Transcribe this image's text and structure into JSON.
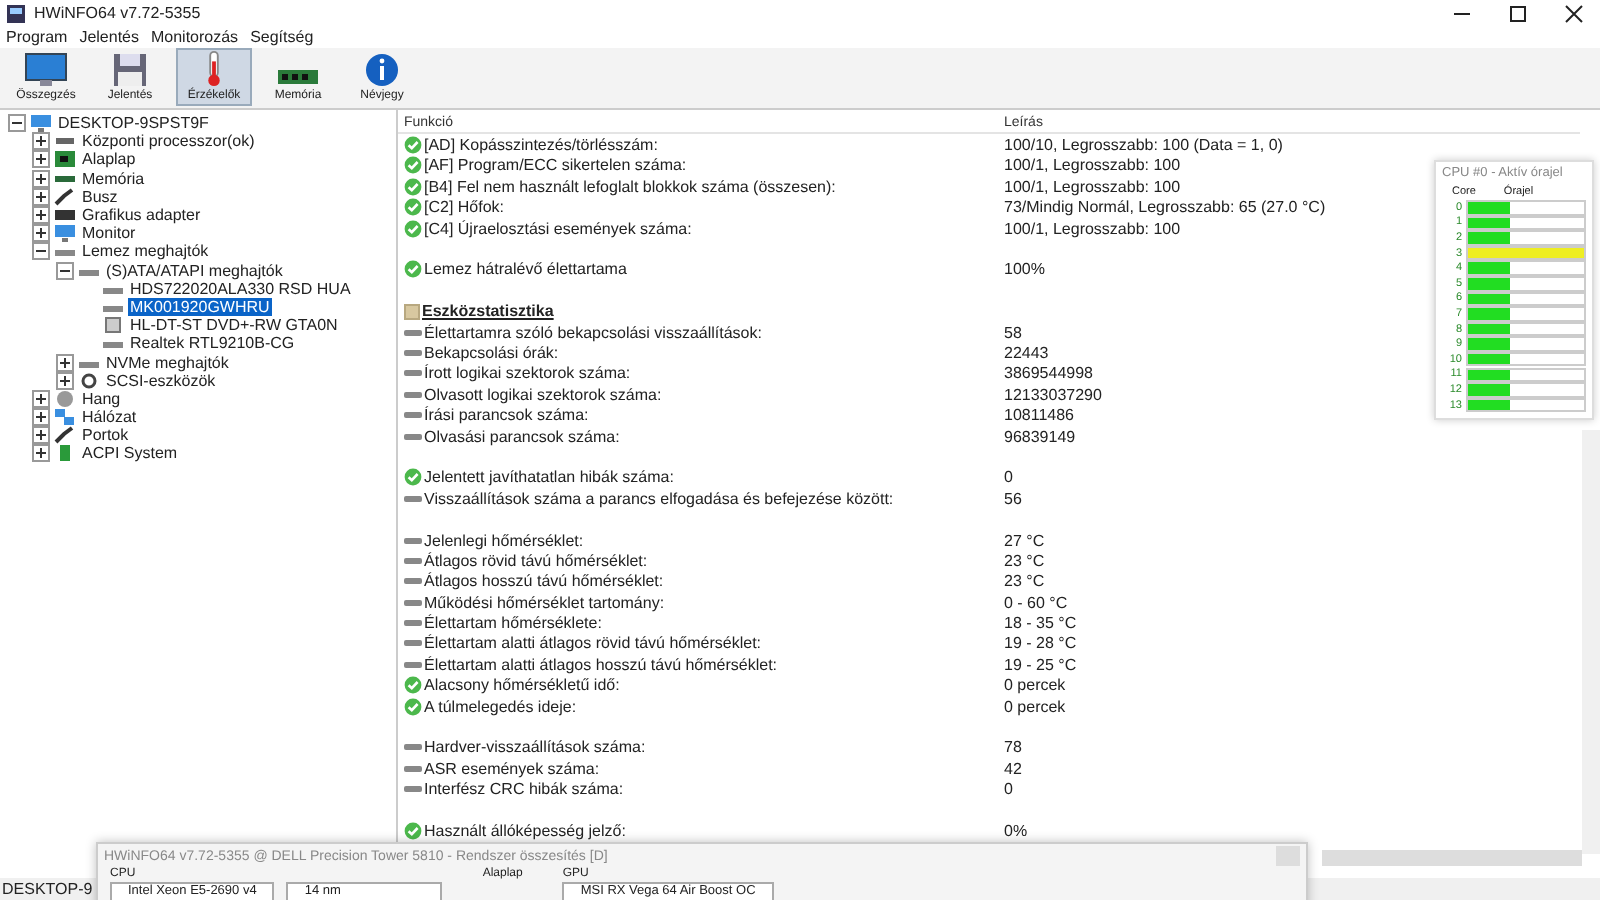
{
  "window": {
    "title": "HWiNFO64 v7.72-5355"
  },
  "menu": [
    "Program",
    "Jelentés",
    "Monitorozás",
    "Segítség"
  ],
  "toolbar": [
    {
      "label": "Összegzés",
      "kind": "monitor",
      "selected": false
    },
    {
      "label": "Jelentés",
      "kind": "floppy",
      "selected": false
    },
    {
      "label": "Érzékelők",
      "kind": "thermometer",
      "selected": true
    },
    {
      "label": "Memória",
      "kind": "memory",
      "selected": false
    },
    {
      "label": "Névjegy",
      "kind": "info",
      "selected": false
    }
  ],
  "tree": {
    "items": [
      {
        "label": "DESKTOP-9SPST9F",
        "kind": "computer",
        "expanded": true,
        "selected": false,
        "children": [
          {
            "label": "Központi processzor(ok)",
            "kind": "cpu",
            "expanded": false,
            "selected": false
          },
          {
            "label": "Alaplap",
            "kind": "board",
            "expanded": false,
            "selected": false
          },
          {
            "label": "Memória",
            "kind": "memory",
            "expanded": false,
            "selected": false
          },
          {
            "label": "Busz",
            "kind": "bus",
            "expanded": false,
            "selected": false
          },
          {
            "label": "Grafikus adapter",
            "kind": "gpu",
            "expanded": false,
            "selected": false
          },
          {
            "label": "Monitor",
            "kind": "monitor",
            "expanded": false,
            "selected": false
          },
          {
            "label": "Lemez meghajtók",
            "kind": "drive",
            "expanded": true,
            "selected": false,
            "children": [
              {
                "label": "(S)ATA/ATAPI meghajtók",
                "kind": "drive",
                "expanded": true,
                "selected": false,
                "children": [
                  {
                    "label": "HDS722020ALA330 RSD HUA",
                    "kind": "drive",
                    "selected": false
                  },
                  {
                    "label": "MK001920GWHRU",
                    "kind": "drive",
                    "selected": true
                  },
                  {
                    "label": "HL-DT-ST DVD+-RW GTA0N",
                    "kind": "optical",
                    "selected": false
                  },
                  {
                    "label": "Realtek RTL9210B-CG",
                    "kind": "drive",
                    "selected": false
                  }
                ]
              },
              {
                "label": "NVMe meghajtók",
                "kind": "drive",
                "expanded": false,
                "selected": false
              },
              {
                "label": "SCSI-eszközök",
                "kind": "gear",
                "expanded": false,
                "selected": false
              }
            ]
          },
          {
            "label": "Hang",
            "kind": "speaker",
            "expanded": false,
            "selected": false
          },
          {
            "label": "Hálózat",
            "kind": "network",
            "expanded": false,
            "selected": false
          },
          {
            "label": "Portok",
            "kind": "bus",
            "expanded": false,
            "selected": false
          },
          {
            "label": "ACPI System",
            "kind": "battery",
            "expanded": false,
            "selected": false
          }
        ]
      }
    ]
  },
  "table": {
    "columns": [
      "Funkció",
      "Leírás"
    ],
    "rows": [
      {
        "kind": "check",
        "label": "[AD] Kopásszintezés/törlésszám:",
        "value": "100/10, Legrosszabb: 100 (Data = 1, 0)",
        "gap_before": false
      },
      {
        "kind": "check",
        "label": "[AF] Program/ECC sikertelen száma:",
        "value": "100/1, Legrosszabb: 100",
        "gap_before": false
      },
      {
        "kind": "check",
        "label": "[B4] Fel nem használt lefoglalt blokkok száma (összesen):",
        "value": "100/1, Legrosszabb: 100",
        "gap_before": false
      },
      {
        "kind": "check",
        "label": "[C2] Hőfok:",
        "value": "73/Mindig Normál, Legrosszabb: 65 (27.0 °C)",
        "gap_before": false
      },
      {
        "kind": "check",
        "label": "[C4] Újraelosztási események száma:",
        "value": "100/1, Legrosszabb: 100",
        "gap_before": false
      },
      {
        "kind": "check",
        "label": "Lemez hátralévő élettartama",
        "value": "100%",
        "gap_before": true
      },
      {
        "kind": "section",
        "label": "Eszközstatisztika",
        "gap_before": true
      },
      {
        "kind": "drive",
        "label": "Élettartamra szóló bekapcsolási visszaállítások:",
        "value": "58",
        "gap_before": false
      },
      {
        "kind": "drive",
        "label": "Bekapcsolási órák:",
        "value": "22443",
        "gap_before": false
      },
      {
        "kind": "drive",
        "label": "Írott logikai szektorok száma:",
        "value": "3869544998",
        "gap_before": false
      },
      {
        "kind": "drive",
        "label": "Olvasott logikai szektorok száma:",
        "value": "12133037290",
        "gap_before": false
      },
      {
        "kind": "drive",
        "label": "Írási parancsok száma:",
        "value": "10811486",
        "gap_before": false
      },
      {
        "kind": "drive",
        "label": "Olvasási parancsok száma:",
        "value": "96839149",
        "gap_before": false
      },
      {
        "kind": "check",
        "label": "Jelentett javíthatatlan hibák száma:",
        "value": "0",
        "gap_before": true
      },
      {
        "kind": "drive",
        "label": "Visszaállítások száma a parancs elfogadása és befejezése között:",
        "value": "56",
        "gap_before": false
      },
      {
        "kind": "drive",
        "label": "Jelenlegi hőmérséklet:",
        "value": "27 °C",
        "gap_before": true
      },
      {
        "kind": "drive",
        "label": "Átlagos rövid távú hőmérséklet:",
        "value": "23 °C",
        "gap_before": false
      },
      {
        "kind": "drive",
        "label": "Átlagos hosszú távú hőmérséklet:",
        "value": "23 °C",
        "gap_before": false
      },
      {
        "kind": "drive",
        "label": "Működési hőmérséklet tartomány:",
        "value": "0 - 60 °C",
        "gap_before": false
      },
      {
        "kind": "drive",
        "label": "Élettartam hőmérséklete:",
        "value": "18 - 35 °C",
        "gap_before": false
      },
      {
        "kind": "drive",
        "label": "Élettartam alatti átlagos rövid távú hőmérséklet:",
        "value": "19 - 28 °C",
        "gap_before": false
      },
      {
        "kind": "drive",
        "label": "Élettartam alatti átlagos hosszú távú hőmérséklet:",
        "value": "19 - 25 °C",
        "gap_before": false
      },
      {
        "kind": "check",
        "label": "Alacsony hőmérsékletű idő:",
        "value": "0 percek",
        "gap_before": false
      },
      {
        "kind": "check",
        "label": "A túlmelegedés ideje:",
        "value": "0 percek",
        "gap_before": false
      },
      {
        "kind": "drive",
        "label": "Hardver-visszaállítások száma:",
        "value": "78",
        "gap_before": true
      },
      {
        "kind": "drive",
        "label": "ASR események száma:",
        "value": "42",
        "gap_before": false
      },
      {
        "kind": "drive",
        "label": "Interfész CRC hibák száma:",
        "value": "0",
        "gap_before": false
      },
      {
        "kind": "check",
        "label": "Használt állóképesség jelző:",
        "value": "0%",
        "gap_before": true
      }
    ]
  },
  "status_bar": {
    "text": "DESKTOP-9"
  },
  "cpu_panel": {
    "title": "CPU #0 - Aktív órajel",
    "columns": [
      "Core",
      "Órajel"
    ],
    "cores": [
      {
        "label": "0",
        "level": 0.37,
        "color": "#22dd22"
      },
      {
        "label": "1",
        "level": 0.37,
        "color": "#22dd22"
      },
      {
        "label": "2",
        "level": 0.37,
        "color": "#22dd22"
      },
      {
        "label": "3",
        "level": 1,
        "color": "#eeee22"
      },
      {
        "label": "4",
        "level": 0.37,
        "color": "#22dd22"
      },
      {
        "label": "5",
        "level": 0.37,
        "color": "#22dd22"
      },
      {
        "label": "6",
        "level": 0.37,
        "color": "#22dd22"
      },
      {
        "label": "7",
        "level": 0.37,
        "color": "#22dd22"
      },
      {
        "label": "8",
        "level": 0.37,
        "color": "#22dd22"
      },
      {
        "label": "9",
        "level": 0.37,
        "color": "#22dd22"
      },
      {
        "label": "10",
        "level": 0.37,
        "color": "#22dd22"
      },
      {
        "label": "11",
        "level": 0.37,
        "color": "#22dd22"
      },
      {
        "label": "12",
        "level": 0.37,
        "color": "#22dd22"
      },
      {
        "label": "13",
        "level": 0.37,
        "color": "#22dd22"
      }
    ]
  },
  "summary_window": {
    "title": "HWiNFO64 v7.72-5355 @ DELL Precision Tower 5810 - Rendszer összesítés [D]",
    "sections": [
      {
        "label": "CPU",
        "fields": [
          "Intel Xeon E5-2690 v4",
          "14 nm"
        ]
      },
      {
        "label": "Alaplap"
      },
      {
        "label": "GPU",
        "fields": [
          "MSI RX Vega 64 Air Boost OC"
        ]
      }
    ]
  }
}
